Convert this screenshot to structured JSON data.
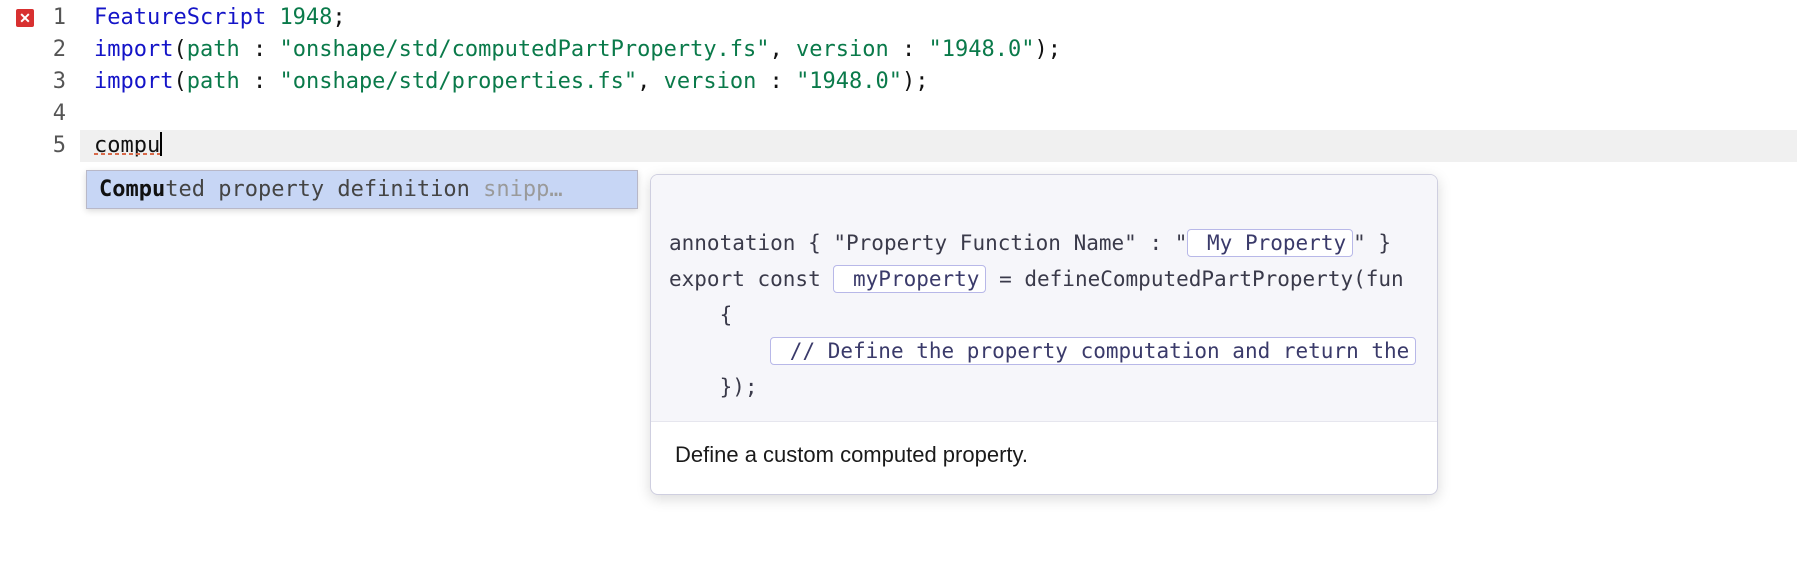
{
  "gutter": {
    "lines": [
      "1",
      "2",
      "3",
      "4",
      "5"
    ],
    "error_on_line": 1
  },
  "code": {
    "line1": {
      "kw": "FeatureScript",
      "num": "1948",
      "semi": ";"
    },
    "line2": {
      "kw": "import",
      "lpar": "(",
      "path_key": "path",
      "colon1": " : ",
      "path_val": "\"onshape/std/computedPartProperty.fs\"",
      "comma": ", ",
      "ver_key": "version",
      "colon2": " : ",
      "ver_val": "\"1948.0\"",
      "rpar_semi": ");"
    },
    "line3": {
      "kw": "import",
      "lpar": "(",
      "path_key": "path",
      "colon1": " : ",
      "path_val": "\"onshape/std/properties.fs\"",
      "comma": ", ",
      "ver_key": "version",
      "colon2": " : ",
      "ver_val": "\"1948.0\"",
      "rpar_semi": ");"
    },
    "line5_typed": "compu"
  },
  "autocomplete": {
    "match": "Compu",
    "rest": "ted property definition",
    "hint": " snipp…"
  },
  "preview": {
    "l1_a": "annotation { ",
    "l1_b": "\"Property Function Name\"",
    "l1_c": " : \"",
    "l1_tok": " My Property",
    "l1_d": "\" }",
    "l2_a": "export const ",
    "l2_tok": " myProperty",
    "l2_b": " = defineComputedPartProperty(fun",
    "l3": "    {",
    "l4_indent": "        ",
    "l4_tok": " // Define the property computation and return the",
    "l5": "    });",
    "description": "Define a custom computed property."
  }
}
